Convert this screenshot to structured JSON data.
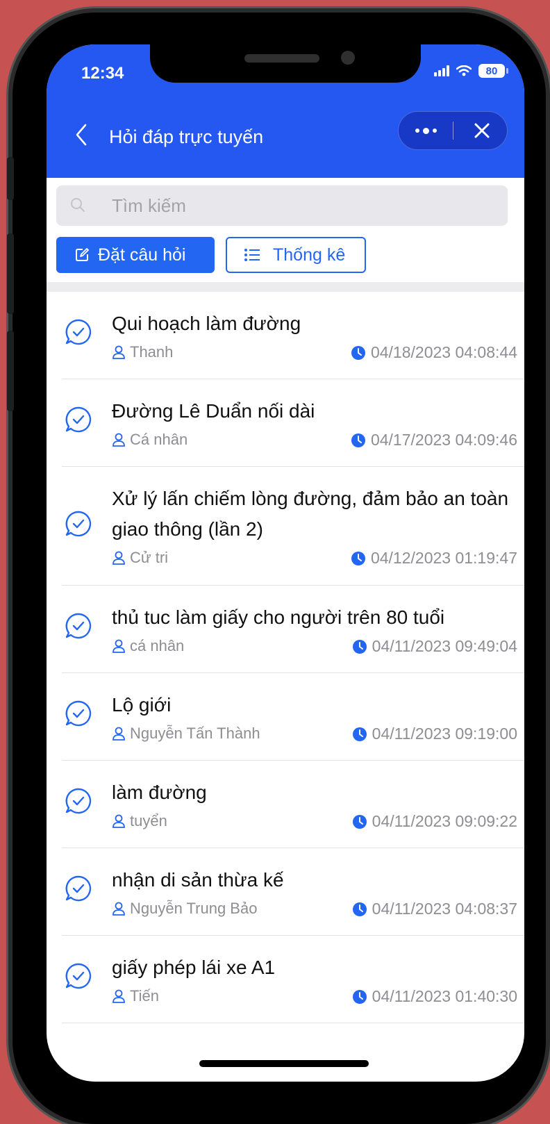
{
  "status_bar": {
    "time": "12:34",
    "battery": "80"
  },
  "nav": {
    "title": "Hỏi đáp trực tuyến"
  },
  "search": {
    "placeholder": "Tìm kiếm"
  },
  "actions": {
    "ask_label": "Đặt câu hỏi",
    "stats_label": "Thống kê"
  },
  "colors": {
    "primary": "#2458f0",
    "accent": "#2266f2",
    "muted_text": "#8d8d93"
  },
  "questions": [
    {
      "title": "Qui hoạch làm đường",
      "user": "Thanh",
      "time": "04/18/2023 04:08:44"
    },
    {
      "title": "Đường Lê Duẩn nối dài",
      "user": "Cá nhân",
      "time": "04/17/2023 04:09:46"
    },
    {
      "title": "Xử lý lấn chiếm lòng đường, đảm bảo an toàn giao thông (lần 2)",
      "user": "Cử tri",
      "time": "04/12/2023 01:19:47"
    },
    {
      "title": "thủ tuc làm giấy cho người trên 80 tuổi",
      "user": "cá nhân",
      "time": "04/11/2023 09:49:04"
    },
    {
      "title": "Lộ giới",
      "user": "Nguyễn Tấn Thành",
      "time": "04/11/2023 09:19:00"
    },
    {
      "title": "làm đường",
      "user": "tuyển",
      "time": "04/11/2023 09:09:22"
    },
    {
      "title": "nhận di sản thừa kế",
      "user": "Nguyễn Trung Bảo",
      "time": "04/11/2023 04:08:37"
    },
    {
      "title": "giấy phép lái xe A1",
      "user": "Tiến",
      "time": "04/11/2023 01:40:30"
    }
  ]
}
